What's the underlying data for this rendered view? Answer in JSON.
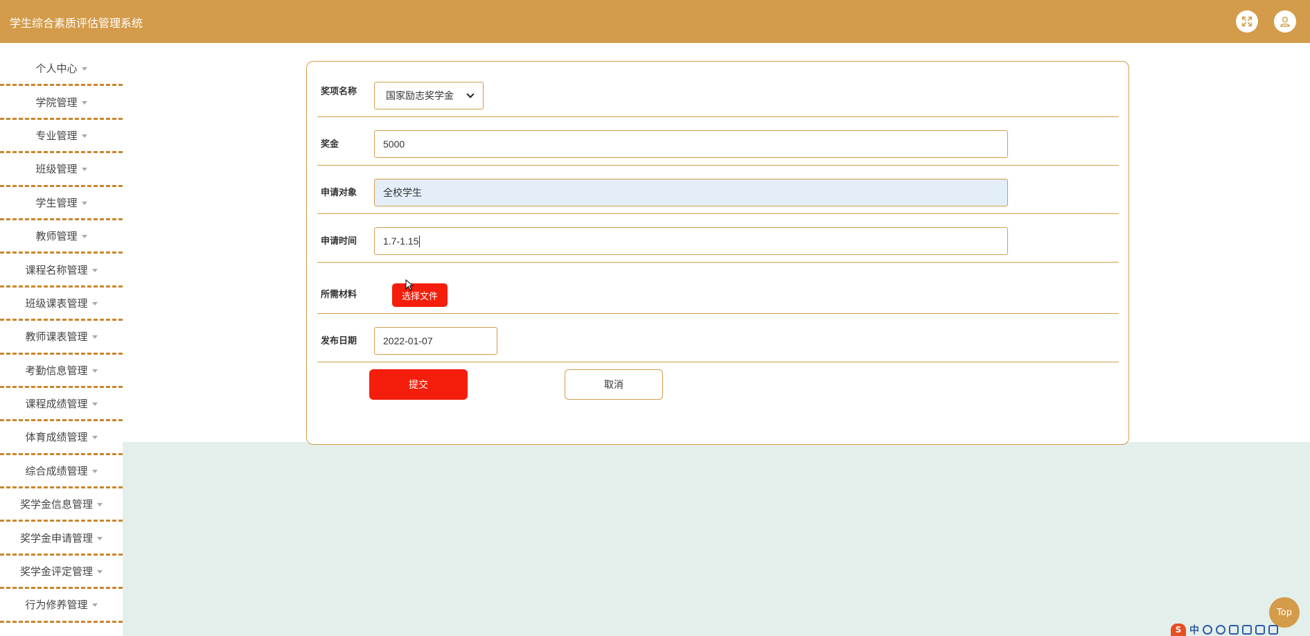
{
  "app": {
    "title": "学生综合素质评估管理系统"
  },
  "header": {
    "fullscreen_icon": "expand-icon",
    "user_icon": "user-icon"
  },
  "sidebar": {
    "items": [
      {
        "label": "个人中心"
      },
      {
        "label": "学院管理"
      },
      {
        "label": "专业管理"
      },
      {
        "label": "班级管理"
      },
      {
        "label": "学生管理"
      },
      {
        "label": "教师管理"
      },
      {
        "label": "课程名称管理"
      },
      {
        "label": "班级课表管理"
      },
      {
        "label": "教师课表管理"
      },
      {
        "label": "考勤信息管理"
      },
      {
        "label": "课程成绩管理"
      },
      {
        "label": "体育成绩管理"
      },
      {
        "label": "综合成绩管理"
      },
      {
        "label": "奖学金信息管理"
      },
      {
        "label": "奖学金申请管理"
      },
      {
        "label": "奖学金评定管理"
      },
      {
        "label": "行为修养管理"
      }
    ]
  },
  "form": {
    "award_name": {
      "label": "奖项名称",
      "value": "国家励志奖学金"
    },
    "amount": {
      "label": "奖金",
      "value": "5000"
    },
    "target": {
      "label": "申请对象",
      "value": "全校学生"
    },
    "apply_time": {
      "label": "申请时间",
      "value": "1.7-1.15"
    },
    "materials": {
      "label": "所需材料",
      "button": "选择文件"
    },
    "publish_date": {
      "label": "发布日期",
      "value": "2022-01-07"
    },
    "submit_label": "提交",
    "cancel_label": "取消"
  },
  "back_to_top": {
    "label": "Top"
  },
  "ime": {
    "char": "中",
    "logo": "S"
  },
  "colors": {
    "accent": "#d39b4a",
    "danger": "#f51d0b",
    "content_bg": "#e3efea",
    "dashed": "#c8862c"
  }
}
